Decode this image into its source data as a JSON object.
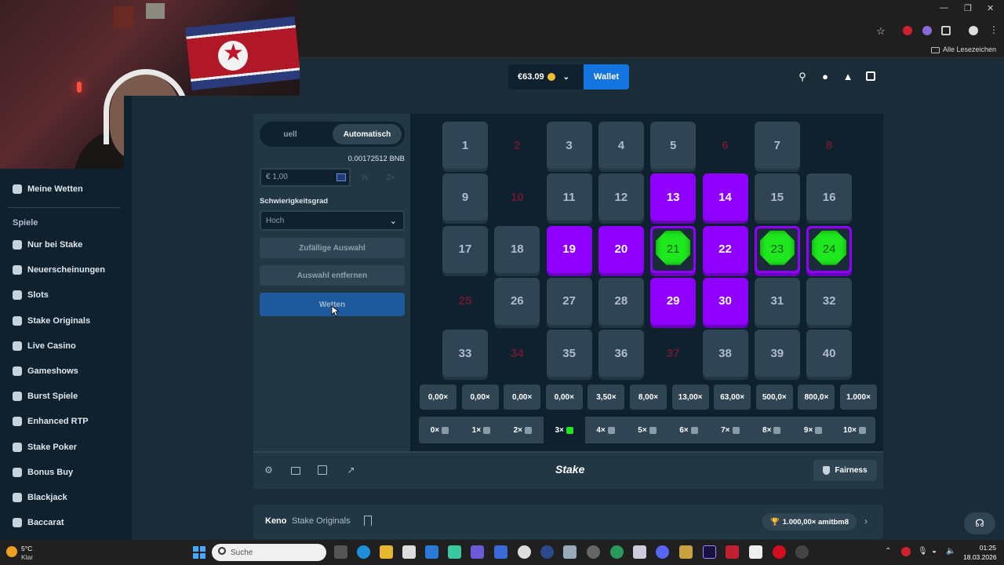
{
  "header": {
    "balance": "€63.09",
    "wallet_label": "Wallet"
  },
  "browser": {
    "bookmarks_label": "Alle Lesezeichen"
  },
  "sidebar": {
    "my_bets": "Meine Wetten",
    "section_label": "Spiele",
    "items": [
      {
        "label": "Nur bei Stake",
        "icon": "stake-icon"
      },
      {
        "label": "Neuerscheinungen",
        "icon": "sparkle-icon"
      },
      {
        "label": "Slots",
        "icon": "slots-icon"
      },
      {
        "label": "Stake Originals",
        "icon": "originals-icon"
      },
      {
        "label": "Live Casino",
        "icon": "live-casino-icon"
      },
      {
        "label": "Gameshows",
        "icon": "gameshows-icon"
      },
      {
        "label": "Burst Spiele",
        "icon": "burst-icon"
      },
      {
        "label": "Enhanced RTP",
        "icon": "rtp-icon"
      },
      {
        "label": "Stake Poker",
        "icon": "poker-icon"
      },
      {
        "label": "Bonus Buy",
        "icon": "bonus-buy-icon"
      },
      {
        "label": "Blackjack",
        "icon": "blackjack-icon"
      },
      {
        "label": "Baccarat",
        "icon": "baccarat-icon"
      }
    ]
  },
  "controls": {
    "tab_manual": "uell",
    "tab_auto": "Automatisch",
    "bet_crypto": "0.00172512 BNB",
    "bet_amount": "€ 1,00",
    "half": "½",
    "double": "2×",
    "difficulty_label": "Schwierigkeitsgrad",
    "difficulty_value": "Hoch",
    "random_pick": "Zufällige Auswahl",
    "clear_table": "Auswahl entfernen",
    "bet_button": "Wetten"
  },
  "grid": {
    "tiles": [
      {
        "n": "1",
        "state": "normal"
      },
      {
        "n": "2",
        "state": "dark"
      },
      {
        "n": "3",
        "state": "normal"
      },
      {
        "n": "4",
        "state": "normal"
      },
      {
        "n": "5",
        "state": "normal"
      },
      {
        "n": "6",
        "state": "dark"
      },
      {
        "n": "7",
        "state": "normal"
      },
      {
        "n": "8",
        "state": "dark"
      },
      {
        "n": "9",
        "state": "normal"
      },
      {
        "n": "10",
        "state": "dark"
      },
      {
        "n": "11",
        "state": "normal"
      },
      {
        "n": "12",
        "state": "normal"
      },
      {
        "n": "13",
        "state": "selected"
      },
      {
        "n": "14",
        "state": "selected"
      },
      {
        "n": "15",
        "state": "normal"
      },
      {
        "n": "16",
        "state": "normal"
      },
      {
        "n": "17",
        "state": "normal"
      },
      {
        "n": "18",
        "state": "normal"
      },
      {
        "n": "19",
        "state": "selected"
      },
      {
        "n": "20",
        "state": "selected"
      },
      {
        "n": "21",
        "state": "hit"
      },
      {
        "n": "22",
        "state": "selected"
      },
      {
        "n": "23",
        "state": "hit"
      },
      {
        "n": "24",
        "state": "hit"
      },
      {
        "n": "25",
        "state": "dark"
      },
      {
        "n": "26",
        "state": "normal"
      },
      {
        "n": "27",
        "state": "normal"
      },
      {
        "n": "28",
        "state": "normal"
      },
      {
        "n": "29",
        "state": "selected"
      },
      {
        "n": "30",
        "state": "selected"
      },
      {
        "n": "31",
        "state": "normal"
      },
      {
        "n": "32",
        "state": "normal"
      },
      {
        "n": "33",
        "state": "normal"
      },
      {
        "n": "34",
        "state": "dark"
      },
      {
        "n": "35",
        "state": "normal"
      },
      {
        "n": "36",
        "state": "normal"
      },
      {
        "n": "37",
        "state": "dark"
      },
      {
        "n": "38",
        "state": "normal"
      },
      {
        "n": "39",
        "state": "normal"
      },
      {
        "n": "40",
        "state": "normal"
      }
    ],
    "multipliers": [
      "0,00×",
      "0,00×",
      "0,00×",
      "0,00×",
      "3,50×",
      "8,00×",
      "13,00×",
      "63,00×",
      "500,0×",
      "800,0×",
      "1.000×"
    ],
    "hits": [
      "0×",
      "1×",
      "2×",
      "3×",
      "4×",
      "5×",
      "6×",
      "7×",
      "8×",
      "9×",
      "10×"
    ],
    "active_hit_index": 3
  },
  "footer": {
    "logo": "Stake",
    "fairness": "Fairness"
  },
  "info": {
    "game_title": "Keno",
    "provider": "Stake Originals",
    "record": "1.000,00× amitbm8"
  },
  "taskbar": {
    "weather_temp": "5°C",
    "weather_desc": "Klar",
    "search_placeholder": "Suche",
    "time": "01:25",
    "date": "18.03.2026"
  },
  "colors": {
    "selected": "#9000ff",
    "gem": "#1fe81f",
    "accent": "#1475e1",
    "background": "#0f212e"
  }
}
